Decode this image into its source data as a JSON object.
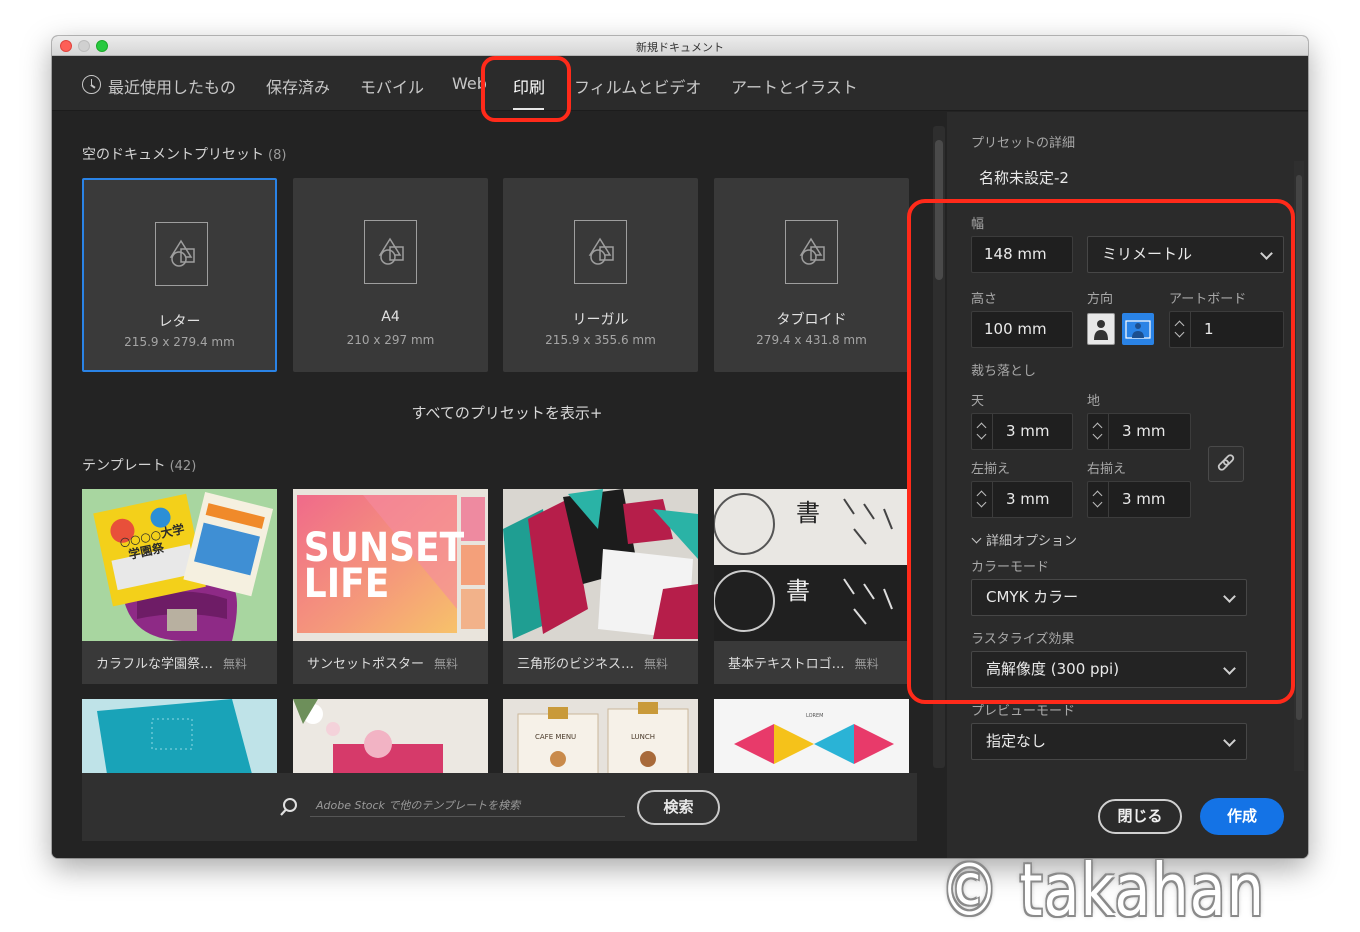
{
  "window": {
    "title": "新規ドキュメント"
  },
  "tabs": [
    {
      "label": "最近使用したもの"
    },
    {
      "label": "保存済み"
    },
    {
      "label": "モバイル"
    },
    {
      "label": "Web"
    },
    {
      "label": "印刷",
      "active": true
    },
    {
      "label": "フィルムとビデオ"
    },
    {
      "label": "アートとイラスト"
    }
  ],
  "presets_section": {
    "title": "空のドキュメントプリセット",
    "count": "(8)"
  },
  "presets": [
    {
      "name": "レター",
      "size": "215.9 x 279.4 mm",
      "selected": true
    },
    {
      "name": "A4",
      "size": "210 x 297 mm"
    },
    {
      "name": "リーガル",
      "size": "215.9 x 355.6 mm"
    },
    {
      "name": "タブロイド",
      "size": "279.4 x 431.8 mm"
    }
  ],
  "show_all_presets": "すべてのプリセットを表示+",
  "templates_section": {
    "title": "テンプレート",
    "count": "(42)"
  },
  "templates": [
    {
      "name": "カラフルな学園祭…",
      "price": "無料",
      "art_text": [
        "○○○○大学",
        "学園祭"
      ]
    },
    {
      "name": "サンセットポスター",
      "price": "無料",
      "art_text": [
        "SUNSET",
        "LIFE"
      ]
    },
    {
      "name": "三角形のビジネス…",
      "price": "無料"
    },
    {
      "name": "基本テキストロゴ…",
      "price": "無料",
      "art_text": [
        "書"
      ]
    }
  ],
  "second_row_art": {
    "menu_text": "CAFE MENU",
    "lunch_text": "LUNCH",
    "lorem_text": "LOREM"
  },
  "search": {
    "placeholder": "Adobe Stock で他のテンプレートを検索",
    "button": "検索"
  },
  "details": {
    "header": "プリセットの詳細",
    "doc_name": "名称未設定-2",
    "width_label": "幅",
    "width_value": "148 mm",
    "unit": "ミリメートル",
    "height_label": "高さ",
    "height_value": "100 mm",
    "orientation_label": "方向",
    "artboard_label": "アートボード",
    "artboard_value": "1",
    "bleed_label": "裁ち落とし",
    "bleed_top_label": "天",
    "bleed_top": "3 mm",
    "bleed_bottom_label": "地",
    "bleed_bottom": "3 mm",
    "bleed_left_label": "左揃え",
    "bleed_left": "3 mm",
    "bleed_right_label": "右揃え",
    "bleed_right": "3 mm",
    "advanced_label": "詳細オプション",
    "color_mode_label": "カラーモード",
    "color_mode": "CMYK カラー",
    "raster_label": "ラスタライズ効果",
    "raster": "高解像度 (300 ppi)",
    "preview_label": "プレビューモード",
    "preview": "指定なし"
  },
  "buttons": {
    "close": "閉じる",
    "create": "作成"
  },
  "watermark": "© takahan",
  "colors": {
    "accent": "#1473e6",
    "highlight": "#ff2a1a",
    "selection": "#2a83e6"
  }
}
